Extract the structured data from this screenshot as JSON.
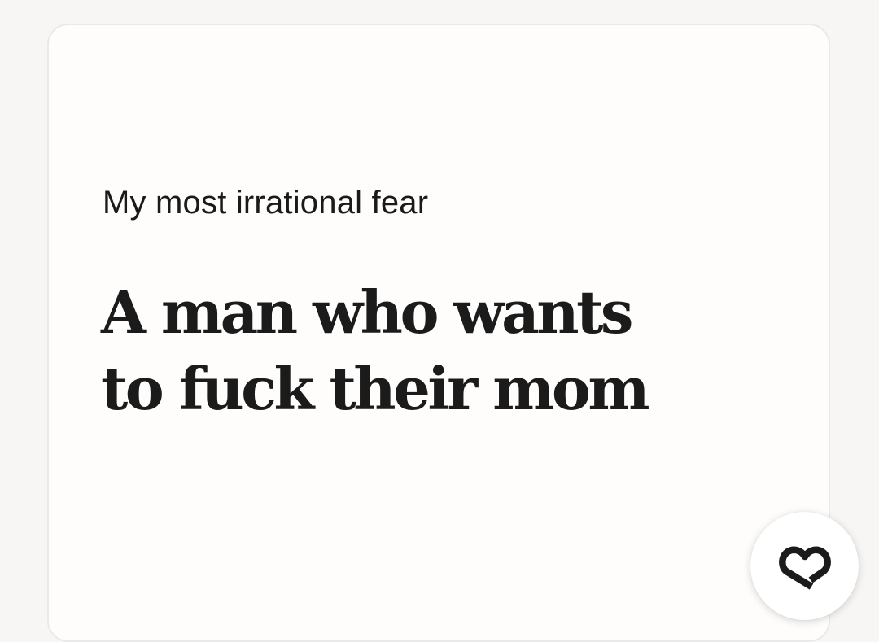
{
  "card": {
    "prompt": "My most irrational fear",
    "answer_line1": "A man who wants",
    "answer_line2": "to fuck their mom"
  },
  "like_button": {
    "icon": "heart-icon",
    "color": "#1b1b1b"
  }
}
